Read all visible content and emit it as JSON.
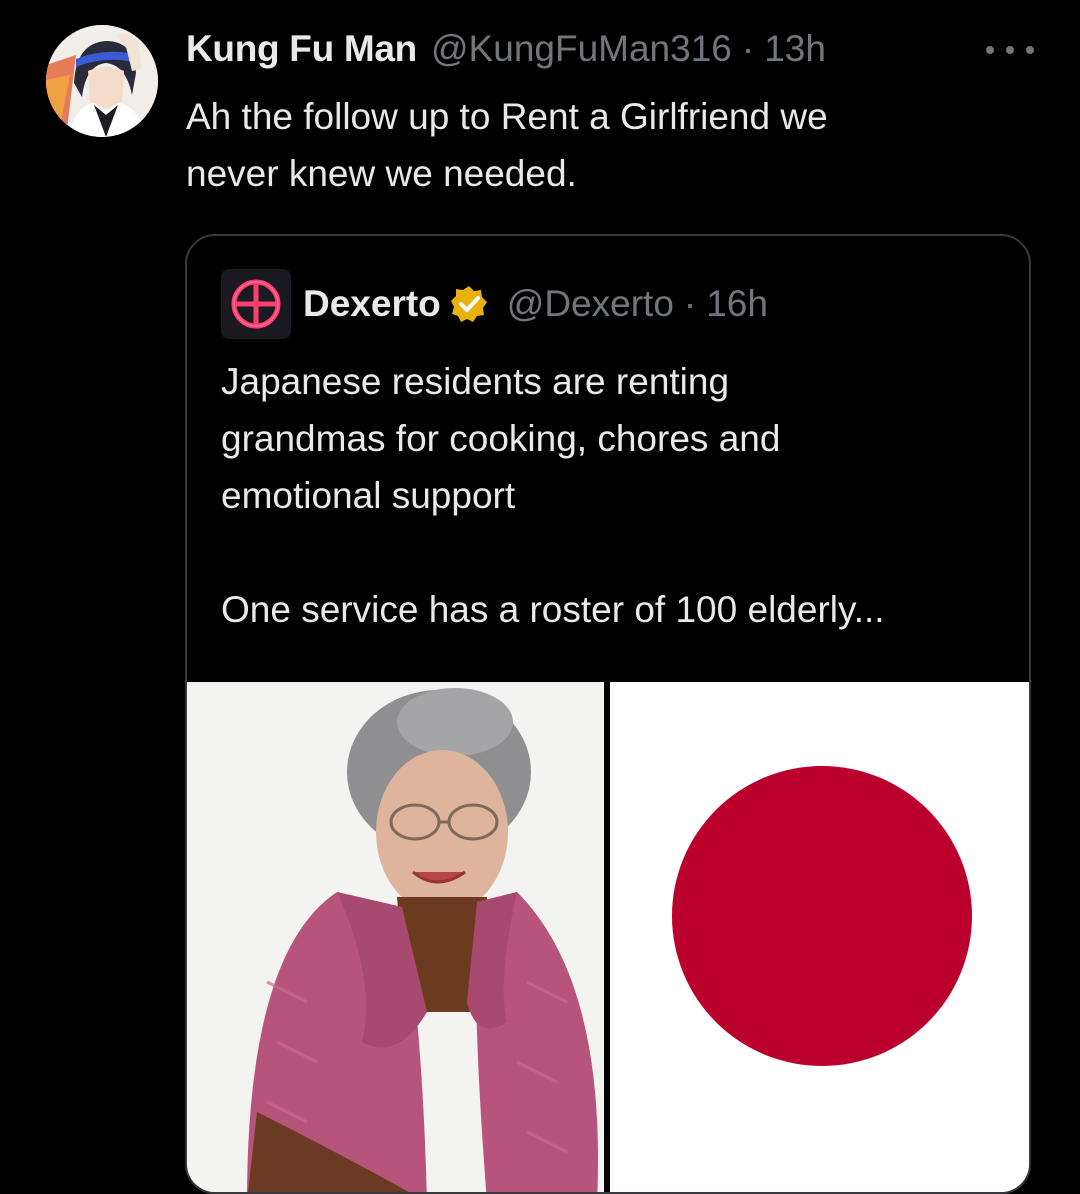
{
  "tweet": {
    "author": {
      "display_name": "Kung Fu Man",
      "handle": "@KungFuMan316",
      "avatar_icon": "anime-character-avatar"
    },
    "separator": "·",
    "time": "13h",
    "more_icon": "more-dots-icon",
    "text": "Ah the follow up to Rent a Girlfriend we\nnever knew we needed."
  },
  "quoted_tweet": {
    "author": {
      "display_name": "Dexerto",
      "handle": "@Dexerto",
      "avatar_icon": "dexerto-logo",
      "verified_icon": "verified-badge-icon",
      "verified_color": "#e8b10f"
    },
    "separator": "·",
    "time": "16h",
    "text": "Japanese residents are renting\ngrandmas for cooking, chores and\nemotional support\n\nOne service has a roster of 100 elderly...",
    "media": [
      {
        "kind": "photo",
        "subject": "elderly-woman-photo"
      },
      {
        "kind": "photo",
        "subject": "japan-flag",
        "color": "#bc002d"
      }
    ]
  },
  "colors": {
    "background": "#000000",
    "text_primary": "#e7e9ea",
    "text_secondary": "#71767b",
    "border": "#38393c"
  }
}
